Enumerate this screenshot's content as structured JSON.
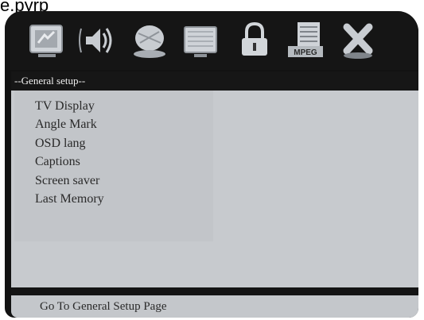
{
  "top_caption": "e.pyrp",
  "header": {
    "title": "--General setup--"
  },
  "toolbar": {
    "icons": [
      {
        "name": "general-setup-icon"
      },
      {
        "name": "audio-setup-icon"
      },
      {
        "name": "dolby-setup-icon"
      },
      {
        "name": "video-setup-icon"
      },
      {
        "name": "lock-icon"
      },
      {
        "name": "mpeg-setup-icon",
        "label": "MPEG"
      },
      {
        "name": "exit-icon"
      }
    ]
  },
  "menu": {
    "items": [
      {
        "label": "TV Display"
      },
      {
        "label": "Angle Mark"
      },
      {
        "label": "OSD lang"
      },
      {
        "label": "Captions"
      },
      {
        "label": "Screen saver"
      },
      {
        "label": "Last Memory"
      }
    ]
  },
  "status": {
    "text": "Go To General Setup Page"
  },
  "colors": {
    "frame": "#121212",
    "panel": "#c7cace",
    "header_text": "#f2f2f2",
    "menu_text": "#2a2a2a"
  }
}
